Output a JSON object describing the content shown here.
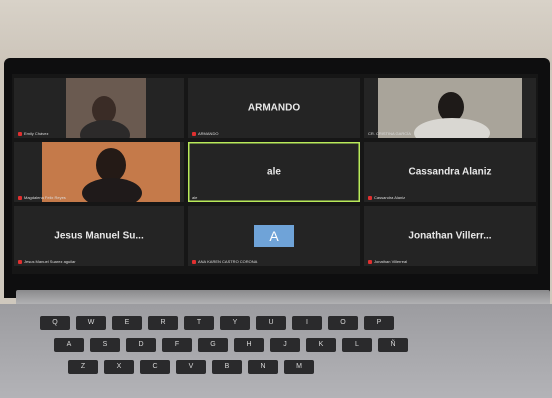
{
  "participants": [
    {
      "id": "emily",
      "label": "Emily Chávez",
      "muted": true
    },
    {
      "id": "armando",
      "name": "ARMANDO",
      "label": "ARMANDO",
      "muted": true
    },
    {
      "id": "cristina",
      "label": "CR. CRISTINA GARCÍA",
      "muted": false
    },
    {
      "id": "magdalena",
      "label": "Magdalena Felix Reyes",
      "muted": true
    },
    {
      "id": "ale",
      "name": "ale",
      "label": "ale",
      "active_speaker": true
    },
    {
      "id": "cassandra",
      "name": "Cassandra Alaniz",
      "label": "Cassandra Alaniz",
      "muted": true
    },
    {
      "id": "jesus",
      "name": "Jesus Manuel Su...",
      "label": "Jesus Manuel Suarez aguilar",
      "muted": true
    },
    {
      "id": "a",
      "avatar_letter": "A",
      "label": "ANA KAREN CASTRO CORONA",
      "muted": true
    },
    {
      "id": "jonathan",
      "name": "Jonathan Villerr...",
      "label": "Jonathan Villerreal",
      "muted": true
    }
  ],
  "keyboard_rows": [
    [
      "Q",
      "W",
      "E",
      "R",
      "T",
      "Y",
      "U",
      "I",
      "O",
      "P"
    ],
    [
      "A",
      "S",
      "D",
      "F",
      "G",
      "H",
      "J",
      "K",
      "L",
      "Ñ"
    ],
    [
      "Z",
      "X",
      "C",
      "V",
      "B",
      "N",
      "M"
    ]
  ],
  "colors": {
    "active_border": "#b9ea5a",
    "mute": "#e03030",
    "avatar": "#6fa3d8"
  }
}
